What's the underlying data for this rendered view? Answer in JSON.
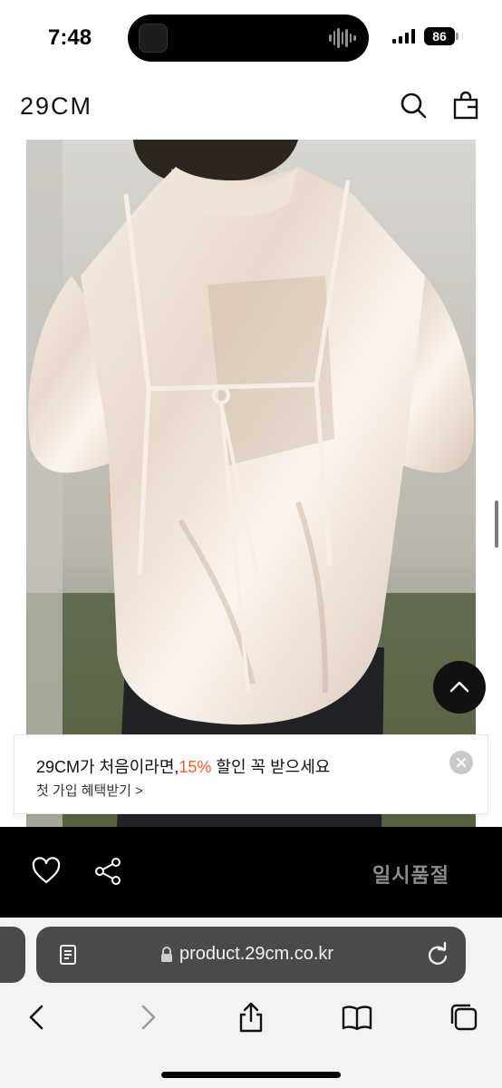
{
  "status_bar": {
    "time": "7:48",
    "battery": "86"
  },
  "header": {
    "logo": "29CM",
    "icons": [
      "search-icon",
      "shopping-bag-icon"
    ]
  },
  "product": {
    "image_alt": "product-photo-satin-blouse"
  },
  "banner": {
    "title_prefix": "29CM가 처음이라면,",
    "title_highlight": "15%",
    "title_suffix": " 할인 꼭 받으세요",
    "link": "첫 가입 혜택받기 >",
    "accent_color": "#ff5a24"
  },
  "action_bar": {
    "status": "일시품절",
    "icons": [
      "heart-icon",
      "share-icon"
    ]
  },
  "browser": {
    "url": "product.29cm.co.kr",
    "toolbar": [
      "back-icon",
      "forward-icon",
      "share-icon",
      "bookmarks-icon",
      "tabs-icon"
    ]
  }
}
